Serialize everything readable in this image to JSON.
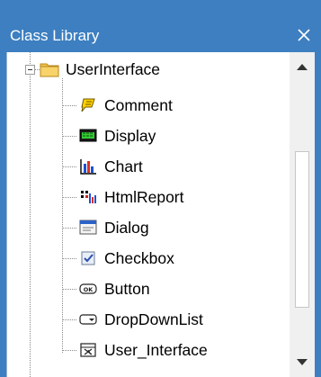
{
  "window": {
    "title": "Class Library",
    "close_glyph": "×"
  },
  "tree": {
    "root": {
      "label": "UserInterface",
      "icon": "folder-icon",
      "expanded": true
    },
    "items": [
      {
        "label": "Comment",
        "icon": "comment-icon"
      },
      {
        "label": "Display",
        "icon": "display-icon"
      },
      {
        "label": "Chart",
        "icon": "chart-icon"
      },
      {
        "label": "HtmlReport",
        "icon": "html-report-icon"
      },
      {
        "label": "Dialog",
        "icon": "dialog-icon"
      },
      {
        "label": "Checkbox",
        "icon": "checkbox-icon"
      },
      {
        "label": "Button",
        "icon": "button-icon"
      },
      {
        "label": "DropDownList",
        "icon": "dropdown-list-icon"
      },
      {
        "label": "User_Interface",
        "icon": "user-interface-icon"
      }
    ]
  },
  "scrollbar": {
    "up_glyph": "▲",
    "down_glyph": "▼"
  },
  "colors": {
    "titlebar": "#3d7fc1",
    "title_text": "#ffffff",
    "tree_background": "#ffffff"
  }
}
